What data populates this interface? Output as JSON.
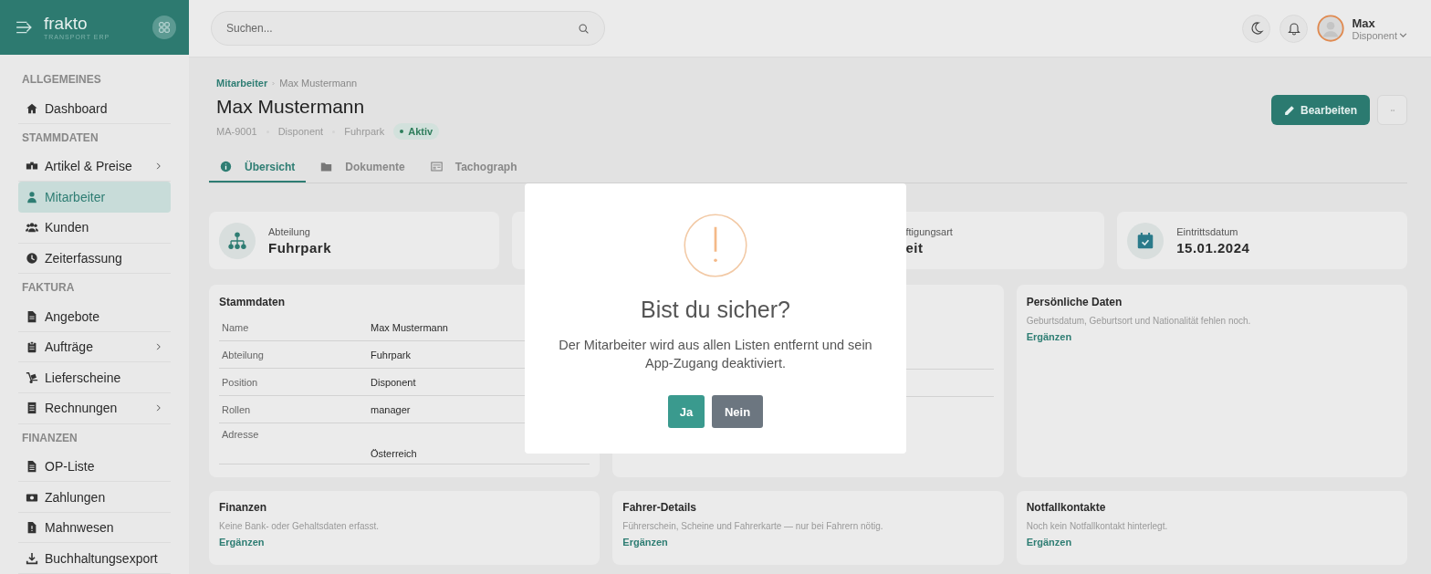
{
  "brand": {
    "name": "frakto",
    "tagline": "TRANSPORT ERP"
  },
  "search": {
    "placeholder": "Suchen..."
  },
  "user": {
    "name": "Max",
    "role": "Disponent"
  },
  "sidebar": {
    "sections": [
      {
        "title": "ALLGEMEINES",
        "items": [
          {
            "label": "Dashboard",
            "selected": false,
            "expandable": false
          }
        ]
      },
      {
        "title": "STAMMDATEN",
        "items": [
          {
            "label": "Artikel & Preise",
            "selected": false,
            "expandable": true
          },
          {
            "label": "Mitarbeiter",
            "selected": true,
            "expandable": false
          },
          {
            "label": "Kunden",
            "selected": false,
            "expandable": false
          },
          {
            "label": "Zeiterfassung",
            "selected": false,
            "expandable": false
          }
        ]
      },
      {
        "title": "FAKTURA",
        "items": [
          {
            "label": "Angebote",
            "selected": false,
            "expandable": false
          },
          {
            "label": "Aufträge",
            "selected": false,
            "expandable": true
          },
          {
            "label": "Lieferscheine",
            "selected": false,
            "expandable": false
          },
          {
            "label": "Rechnungen",
            "selected": false,
            "expandable": true
          }
        ]
      },
      {
        "title": "FINANZEN",
        "items": [
          {
            "label": "OP-Liste",
            "selected": false,
            "expandable": false
          },
          {
            "label": "Zahlungen",
            "selected": false,
            "expandable": false
          },
          {
            "label": "Mahnwesen",
            "selected": false,
            "expandable": false
          },
          {
            "label": "Buchhaltungsexport",
            "selected": false,
            "expandable": false
          }
        ]
      }
    ]
  },
  "breadcrumb": [
    {
      "label": "Mitarbeiter",
      "kind": "link"
    },
    {
      "label": "Max Mustermann",
      "kind": "current"
    }
  ],
  "title": "Max Mustermann",
  "meta": [
    "MA-9001",
    "Disponent",
    "Fuhrpark"
  ],
  "status": {
    "label": "Aktiv",
    "color": "#2e7d5b"
  },
  "actions": {
    "edit": "Bearbeiten"
  },
  "tabs": [
    {
      "label": "Übersicht",
      "selected": true
    },
    {
      "label": "Dokumente",
      "selected": false
    },
    {
      "label": "Tachograph",
      "selected": false
    }
  ],
  "stats": [
    {
      "kind": "full",
      "label": "Abteilung",
      "value": "Fuhrpark"
    },
    {
      "kind": "covered"
    },
    {
      "kind": "partial",
      "label": "ftigungsart",
      "value": "eit"
    },
    {
      "kind": "full",
      "label": "Eintrittsdatum",
      "value": "15.01.2024"
    }
  ],
  "cards": [
    {
      "kind": "table",
      "title": "Stammdaten",
      "rows": [
        {
          "label": "Name",
          "value": "Max Mustermann"
        },
        {
          "label": "Abteilung",
          "value": "Fuhrpark"
        },
        {
          "label": "Position",
          "value": "Disponent"
        },
        {
          "label": "Rollen",
          "value": "manager"
        },
        {
          "label": "Adresse",
          "value": "Österreich"
        }
      ]
    },
    {
      "kind": "covered"
    },
    {
      "kind": "note",
      "title": "Persönliche Daten",
      "note": "Geburtsdatum, Geburtsort und Nationalität fehlen noch.",
      "link": "Ergänzen"
    },
    {
      "kind": "note",
      "title": "Finanzen",
      "note": "Keine Bank- oder Gehaltsdaten erfasst.",
      "link": "Ergänzen"
    },
    {
      "kind": "note",
      "title": "Fahrer-Details",
      "note": "Führerschein, Scheine und Fahrerkarte — nur bei Fahrern nötig.",
      "link": "Ergänzen"
    },
    {
      "kind": "note",
      "title": "Notfallkontakte",
      "note": "Noch kein Notfallkontakt hinterlegt.",
      "link": "Ergänzen"
    }
  ],
  "dialog": {
    "title": "Bist du sicher?",
    "text": "Der Mitarbeiter wird aus allen Listen entfernt und sein App-Zugang deaktiviert.",
    "confirm": "Ja",
    "cancel": "Nein"
  }
}
